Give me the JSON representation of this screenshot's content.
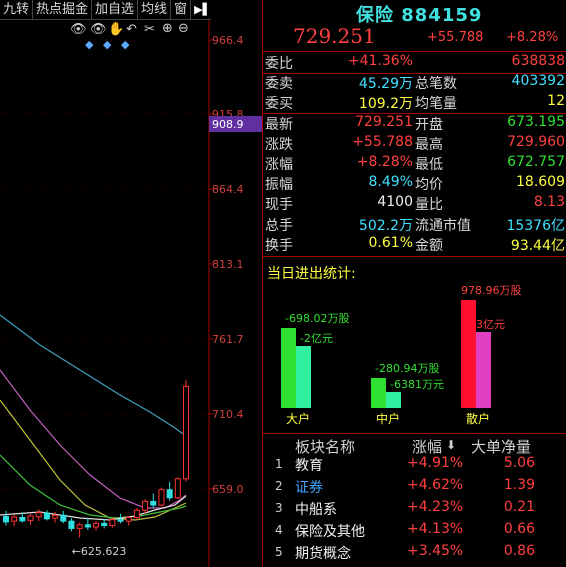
{
  "toolbar": {
    "items": [
      "九转",
      "热点掘金",
      "加自选",
      "均线",
      "窗"
    ],
    "arrow": "▶▌"
  },
  "chart_icons": [
    "eye-icon",
    "eye-icon",
    "hand-icon",
    "undo-icon",
    "scissors-icon",
    "zoom-in-icon",
    "zoom-out-icon"
  ],
  "chart_data": {
    "type": "candlestick",
    "y_ticks": [
      "966.4",
      "915.8",
      "864.4",
      "813.1",
      "761.7",
      "710.4",
      "659.0"
    ],
    "y_values": [
      966.4,
      915.8,
      864.4,
      813.1,
      761.7,
      710.4,
      659.0
    ],
    "current_marker": "908.9",
    "low_annotation": "625.623",
    "low_value": 625.623,
    "last_high": 733.5,
    "last_close": 729.251,
    "candles": [
      {
        "o": 640.2,
        "h": 644.0,
        "l": 634.0,
        "c": 636.5
      },
      {
        "o": 637.0,
        "h": 641.5,
        "l": 633.5,
        "c": 639.8
      },
      {
        "o": 639.5,
        "h": 643.0,
        "l": 636.0,
        "c": 637.2
      },
      {
        "o": 637.5,
        "h": 642.0,
        "l": 634.5,
        "c": 640.5
      },
      {
        "o": 640.0,
        "h": 645.0,
        "l": 637.0,
        "c": 642.8
      },
      {
        "o": 642.5,
        "h": 644.5,
        "l": 637.5,
        "c": 638.6
      },
      {
        "o": 639.0,
        "h": 643.5,
        "l": 636.0,
        "c": 641.0
      },
      {
        "o": 641.0,
        "h": 644.0,
        "l": 635.5,
        "c": 637.0
      },
      {
        "o": 637.0,
        "h": 639.0,
        "l": 630.0,
        "c": 632.0
      },
      {
        "o": 632.0,
        "h": 636.0,
        "l": 625.6,
        "c": 634.5
      },
      {
        "o": 634.5,
        "h": 639.0,
        "l": 631.0,
        "c": 633.0
      },
      {
        "o": 633.0,
        "h": 637.0,
        "l": 630.5,
        "c": 635.5
      },
      {
        "o": 635.5,
        "h": 638.5,
        "l": 632.0,
        "c": 634.0
      },
      {
        "o": 634.0,
        "h": 639.5,
        "l": 632.5,
        "c": 638.0
      },
      {
        "o": 638.0,
        "h": 642.0,
        "l": 635.5,
        "c": 637.0
      },
      {
        "o": 637.0,
        "h": 640.5,
        "l": 634.0,
        "c": 639.5
      },
      {
        "o": 639.5,
        "h": 646.0,
        "l": 637.5,
        "c": 644.5
      },
      {
        "o": 644.5,
        "h": 652.0,
        "l": 642.0,
        "c": 650.5
      },
      {
        "o": 650.5,
        "h": 656.0,
        "l": 646.0,
        "c": 648.0
      },
      {
        "o": 648.0,
        "h": 660.0,
        "l": 647.0,
        "c": 658.5
      },
      {
        "o": 658.5,
        "h": 664.0,
        "l": 651.0,
        "c": 653.0
      },
      {
        "o": 653.0,
        "h": 667.0,
        "l": 652.0,
        "c": 666.0
      },
      {
        "o": 666.0,
        "h": 733.5,
        "l": 664.0,
        "c": 729.3
      }
    ]
  },
  "quote": {
    "title": "保险 884159",
    "price": "729.251",
    "change": "+55.788",
    "change_pct": "+8.28%",
    "rows": [
      {
        "l1": "委比",
        "v1": "+41.36%",
        "c1": "red",
        "l2": "",
        "v2": "638838",
        "c2": "red"
      },
      {
        "l1": "委卖",
        "v1": "45.29万",
        "c1": "cyan",
        "l2": "总笔数",
        "v2": "403392",
        "c2": "cyan"
      },
      {
        "l1": "委买",
        "v1": "109.2万",
        "c1": "yellow",
        "l2": "均笔量",
        "v2": "12",
        "c2": "yellow"
      },
      {
        "l1": "最新",
        "v1": "729.251",
        "c1": "red",
        "l2": "开盘",
        "v2": "673.195",
        "c2": "green"
      },
      {
        "l1": "涨跌",
        "v1": "+55.788",
        "c1": "red",
        "l2": "最高",
        "v2": "729.960",
        "c2": "red"
      },
      {
        "l1": "涨幅",
        "v1": "+8.28%",
        "c1": "red",
        "l2": "最低",
        "v2": "672.757",
        "c2": "green"
      },
      {
        "l1": "振幅",
        "v1": "8.49%",
        "c1": "cyan",
        "l2": "均价",
        "v2": "18.609",
        "c2": "yellow"
      },
      {
        "l1": "现手",
        "v1": "4100",
        "c1": "white",
        "l2": "量比",
        "v2": "8.13",
        "c2": "red"
      },
      {
        "l1": "总手",
        "v1": "502.2万",
        "c1": "cyan",
        "l2": "流通市值",
        "v2": "15376亿",
        "c2": "cyan"
      },
      {
        "l1": "换手",
        "v1": "0.61%",
        "c1": "yellow",
        "l2": "金额",
        "v2": "93.44亿",
        "c2": "yellow"
      }
    ]
  },
  "flow": {
    "title": "当日进出统计:",
    "groups": [
      {
        "label": "大户",
        "top_text": "-698.02万股",
        "second_text": "-2亿元",
        "h1": 80,
        "h2": 62,
        "color1": "#30e030",
        "color2": "#30f0a0"
      },
      {
        "label": "中户",
        "top_text": "-280.94万股",
        "second_text": "-6381万元",
        "h1": 30,
        "h2": 16,
        "color1": "#30e030",
        "color2": "#30f0a0"
      },
      {
        "label": "散户",
        "top_text": "978.96万股",
        "second_text": "3亿元",
        "h1": 108,
        "h2": 76,
        "color1": "#ff1030",
        "color2": "#e040c0"
      }
    ]
  },
  "sectors": {
    "headers": [
      "板块名称",
      "涨幅",
      "大单净量"
    ],
    "sort_icon": "⬇",
    "rows": [
      {
        "num": "1",
        "name": "教育",
        "pct": "+4.91%",
        "net": "5.06",
        "name_color": "#f0f0f0"
      },
      {
        "num": "2",
        "name": "证券",
        "pct": "+4.62%",
        "net": "1.39",
        "name_color": "#40a0ff"
      },
      {
        "num": "3",
        "name": "中船系",
        "pct": "+4.23%",
        "net": "0.21",
        "name_color": "#f0f0f0"
      },
      {
        "num": "4",
        "name": "保险及其他",
        "pct": "+4.13%",
        "net": "0.66",
        "name_color": "#f0f0f0"
      },
      {
        "num": "5",
        "name": "期货概念",
        "pct": "+3.45%",
        "net": "0.86",
        "name_color": "#f0f0f0"
      }
    ]
  }
}
